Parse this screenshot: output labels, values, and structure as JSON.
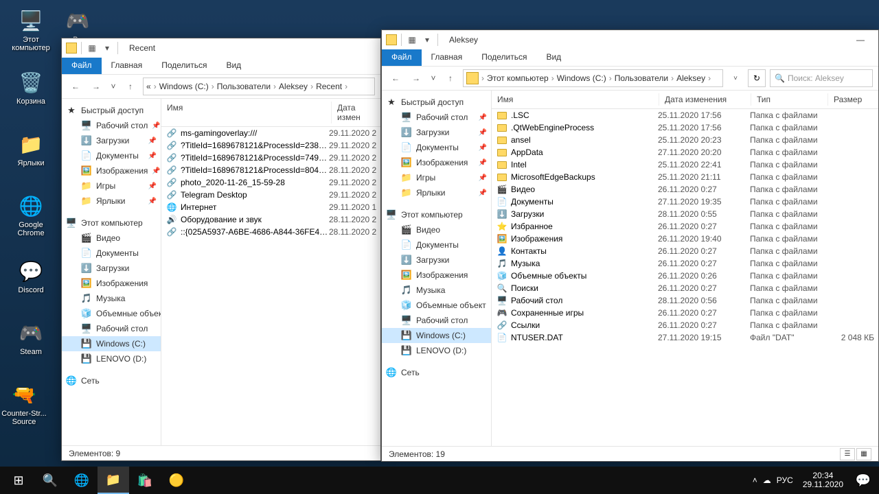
{
  "desktop": [
    {
      "name": "this-pc",
      "label": "Этот\nкомпьютер",
      "emoji": "🖥️"
    },
    {
      "name": "battlefield",
      "label": "Ba",
      "emoji": "🎮"
    },
    {
      "name": "recycle-bin",
      "label": "Корзина",
      "emoji": "🗑️"
    },
    {
      "name": "shortcuts",
      "label": "Ярлыки",
      "emoji": "📁"
    },
    {
      "name": "chrome",
      "label": "Google\nChrome",
      "emoji": "🌐"
    },
    {
      "name": "discord",
      "label": "Discord",
      "emoji": "💬"
    },
    {
      "name": "steam",
      "label": "Steam",
      "emoji": "🎮"
    },
    {
      "name": "cs-source",
      "label": "Counter-Str...\nSource",
      "emoji": "🔫"
    }
  ],
  "win1": {
    "title": "Recent",
    "ribbon": [
      "Файл",
      "Главная",
      "Поделиться",
      "Вид"
    ],
    "crumbs": [
      "«",
      "Windows (C:)",
      "Пользователи",
      "Aleksey",
      "Recent"
    ],
    "cols": {
      "name": "Имя",
      "date": "Дата измен"
    },
    "navquick": {
      "header": "Быстрый доступ",
      "items": [
        "Рабочий стол",
        "Загрузки",
        "Документы",
        "Изображения",
        "Игры",
        "Ярлыки"
      ]
    },
    "navpc": {
      "header": "Этот компьютер",
      "items": [
        "Видео",
        "Документы",
        "Загрузки",
        "Изображения",
        "Музыка",
        "Объемные объект",
        "Рабочий стол",
        "Windows (C:)",
        "LENOVO (D:)"
      ]
    },
    "navnet": "Сеть",
    "files": [
      {
        "n": "ms-gamingoverlay:///",
        "d": "29.11.2020 2",
        "t": "link"
      },
      {
        "n": "?TitleId=1689678121&ProcessId=2384&...",
        "d": "29.11.2020 2",
        "t": "link"
      },
      {
        "n": "?TitleId=1689678121&ProcessId=7492&...",
        "d": "29.11.2020 2",
        "t": "link"
      },
      {
        "n": "?TitleId=1689678121&ProcessId=8048&...",
        "d": "28.11.2020 2",
        "t": "link"
      },
      {
        "n": "photo_2020-11-26_15-59-28",
        "d": "29.11.2020 2",
        "t": "link"
      },
      {
        "n": "Telegram Desktop",
        "d": "29.11.2020 2",
        "t": "link"
      },
      {
        "n": "Интернет",
        "d": "29.11.2020 1",
        "t": "link"
      },
      {
        "n": "Оборудование и звук",
        "d": "28.11.2020 2",
        "t": "link"
      },
      {
        "n": "::{025A5937-A6BE-4686-A844-36FE4BEC8...",
        "d": "28.11.2020 2",
        "t": "link"
      }
    ],
    "status": "Элементов: 9"
  },
  "win2": {
    "title": "Aleksey",
    "ribbon": [
      "Файл",
      "Главная",
      "Поделиться",
      "Вид"
    ],
    "crumbs": [
      "Этот компьютер",
      "Windows (C:)",
      "Пользователи",
      "Aleksey"
    ],
    "searchPlaceholder": "Поиск: Aleksey",
    "cols": {
      "name": "Имя",
      "date": "Дата изменения",
      "type": "Тип",
      "size": "Размер"
    },
    "navquick": {
      "header": "Быстрый доступ",
      "items": [
        "Рабочий стол",
        "Загрузки",
        "Документы",
        "Изображения",
        "Игры",
        "Ярлыки"
      ]
    },
    "navpc": {
      "header": "Этот компьютер",
      "items": [
        "Видео",
        "Документы",
        "Загрузки",
        "Изображения",
        "Музыка",
        "Объемные объект",
        "Рабочий стол",
        "Windows (C:)",
        "LENOVO (D:)"
      ]
    },
    "navnet": "Сеть",
    "files": [
      {
        "n": ".LSC",
        "d": "25.11.2020 17:56",
        "t": "Папка с файлами",
        "s": ""
      },
      {
        "n": ".QtWebEngineProcess",
        "d": "25.11.2020 17:56",
        "t": "Папка с файлами",
        "s": ""
      },
      {
        "n": "ansel",
        "d": "25.11.2020 20:23",
        "t": "Папка с файлами",
        "s": ""
      },
      {
        "n": "AppData",
        "d": "27.11.2020 20:20",
        "t": "Папка с файлами",
        "s": ""
      },
      {
        "n": "Intel",
        "d": "25.11.2020 22:41",
        "t": "Папка с файлами",
        "s": ""
      },
      {
        "n": "MicrosoftEdgeBackups",
        "d": "25.11.2020 21:11",
        "t": "Папка с файлами",
        "s": ""
      },
      {
        "n": "Видео",
        "d": "26.11.2020 0:27",
        "t": "Папка с файлами",
        "s": ""
      },
      {
        "n": "Документы",
        "d": "27.11.2020 19:35",
        "t": "Папка с файлами",
        "s": ""
      },
      {
        "n": "Загрузки",
        "d": "28.11.2020 0:55",
        "t": "Папка с файлами",
        "s": ""
      },
      {
        "n": "Избранное",
        "d": "26.11.2020 0:27",
        "t": "Папка с файлами",
        "s": ""
      },
      {
        "n": "Изображения",
        "d": "26.11.2020 19:40",
        "t": "Папка с файлами",
        "s": ""
      },
      {
        "n": "Контакты",
        "d": "26.11.2020 0:27",
        "t": "Папка с файлами",
        "s": ""
      },
      {
        "n": "Музыка",
        "d": "26.11.2020 0:27",
        "t": "Папка с файлами",
        "s": ""
      },
      {
        "n": "Объемные объекты",
        "d": "26.11.2020 0:26",
        "t": "Папка с файлами",
        "s": ""
      },
      {
        "n": "Поиски",
        "d": "26.11.2020 0:27",
        "t": "Папка с файлами",
        "s": ""
      },
      {
        "n": "Рабочий стол",
        "d": "28.11.2020 0:56",
        "t": "Папка с файлами",
        "s": ""
      },
      {
        "n": "Сохраненные игры",
        "d": "26.11.2020 0:27",
        "t": "Папка с файлами",
        "s": ""
      },
      {
        "n": "Ссылки",
        "d": "26.11.2020 0:27",
        "t": "Папка с файлами",
        "s": ""
      },
      {
        "n": "NTUSER.DAT",
        "d": "27.11.2020 19:15",
        "t": "Файл \"DAT\"",
        "s": "2 048 КБ"
      }
    ],
    "status": "Элементов: 19"
  },
  "taskbar": {
    "time": "20:34",
    "date": "29.11.2020",
    "lang": "РУС"
  }
}
